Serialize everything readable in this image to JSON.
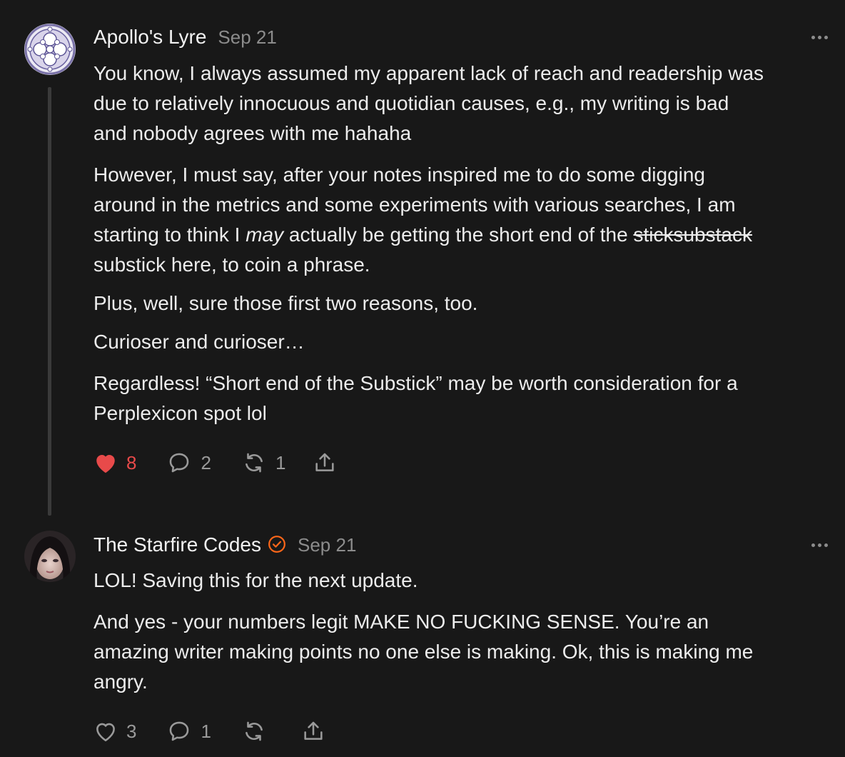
{
  "comments": [
    {
      "author": "Apollo's Lyre",
      "date": "Sep 21",
      "paragraphs": {
        "p1_line1": "You know, I always assumed my apparent lack of reach and readership was",
        "p1_line2": "due to relatively innocuous and quotidian causes, e.g., my writing is bad",
        "p1_line3": "and nobody agrees with me hahaha",
        "p2_line1": "However, I must say, after your notes inspired me to do some digging",
        "p2_line2": "around in the metrics and some experiments with various searches, I am",
        "p2_line3_pre": "starting to think I ",
        "p2_line3_em": "may",
        "p2_line3_mid": " actually be getting the short end of the ",
        "p2_line3_strike": "sticksubstack",
        "p2_line4": "substick here, to coin a phrase.",
        "p3": "Plus, well, sure those first two reasons, too.",
        "p4": "Curioser and curioser…",
        "p5_line1": "Regardless! “Short end of the Substick” may be worth consideration for a",
        "p5_line2": "Perplexicon spot lol"
      },
      "likes": "8",
      "replies": "2",
      "restacks": "1",
      "liked": true
    },
    {
      "author": "The Starfire Codes",
      "date": "Sep 21",
      "verified": true,
      "paragraphs": {
        "p1": "LOL! Saving this for the next update.",
        "p2_line1": "And yes - your numbers legit MAKE NO FUCKING SENSE. You’re an",
        "p2_line2": "amazing writer making points no one else is making. Ok, this is making me",
        "p2_line3": "angry."
      },
      "likes": "3",
      "replies": "1",
      "liked": false
    }
  ],
  "colors": {
    "background": "#181818",
    "text": "#ececec",
    "muted": "#8c8c8c",
    "like": "#e84a4a",
    "verified": "#ff6719"
  },
  "icons": [
    "heart-icon",
    "comment-icon",
    "restack-icon",
    "share-icon",
    "more-icon",
    "verified-badge-icon"
  ]
}
